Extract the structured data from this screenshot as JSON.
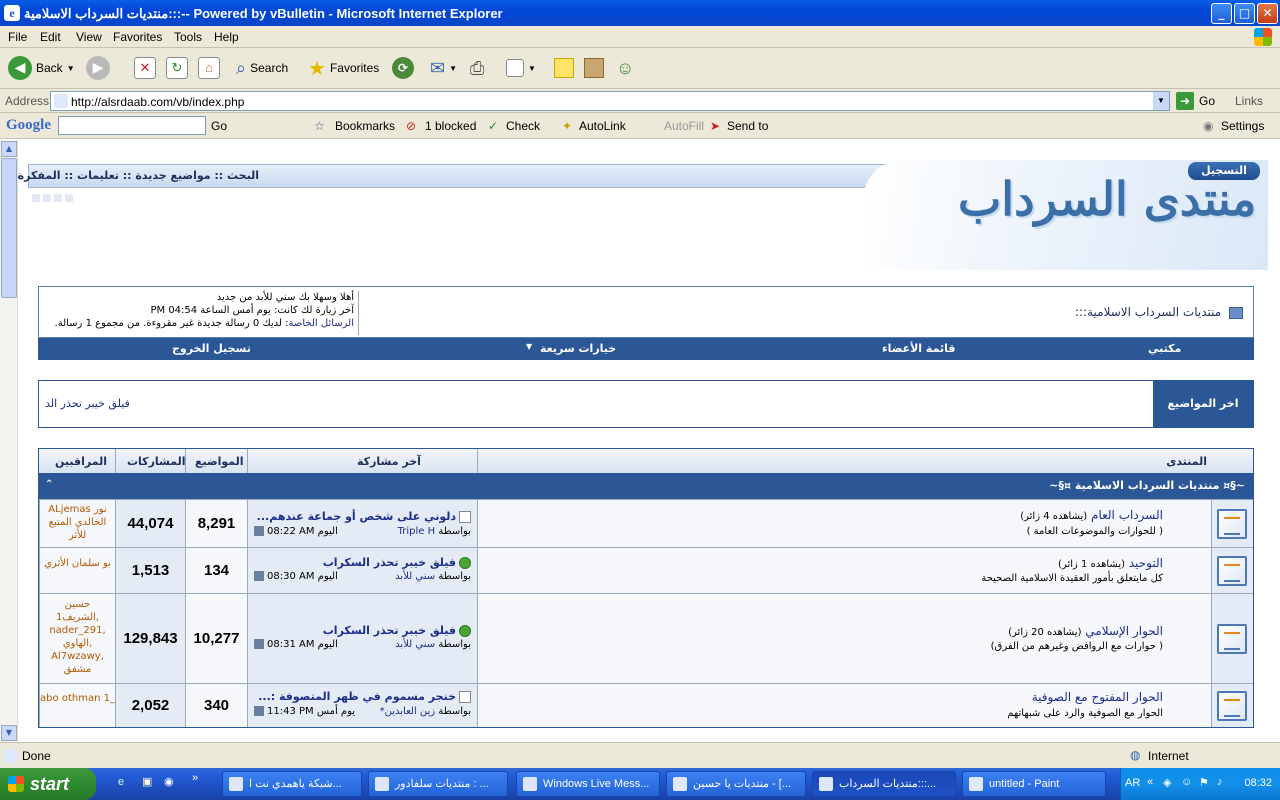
{
  "window": {
    "title": "منتديات السرداب الاسلامية:::-- Powered by vBulletin - Microsoft Internet Explorer",
    "min": "_",
    "max": "□",
    "close": "✕"
  },
  "menu": [
    "File",
    "Edit",
    "View",
    "Favorites",
    "Tools",
    "Help"
  ],
  "toolbar": {
    "back": "Back",
    "search": "Search",
    "favorites": "Favorites"
  },
  "address": {
    "label": "Address",
    "url": "http://alsrdaab.com/vb/index.php",
    "go": "Go",
    "links": "Links"
  },
  "google": {
    "logo": "Google",
    "go": "Go",
    "bookmarks": "Bookmarks",
    "blocked": "1 blocked",
    "check": "Check",
    "autolink": "AutoLink",
    "autofill": "AutoFill",
    "sendto": "Send to",
    "settings": "Settings"
  },
  "forum": {
    "header_links": "البحث :: مواضيع جديدة :: تعليمات :: المفكرة",
    "register": "التسجيل",
    "logo": "منتدى السرداب",
    "breadcrumb": "منتديات السرداب الاسلامية:::",
    "welcome": "أهلا وسهلا بك سني للأبد من جديد",
    "last_visit": "آخر زيارة لك كانت: يوم أمس الساعة 04:54 PM",
    "pm_label": "الرسائل الخاصة",
    "pm_text": ": لديك 0 رسالة جديدة غير مقروءة. من مجموع 1 رسالة.",
    "nav": {
      "office": "مكتبي",
      "members": "قائمة الأعضاء",
      "quick": "خيارات سريعة",
      "logout": "تسجيل الخروج"
    },
    "latest_tag": "اخر المواضيع",
    "latest_item": "فيلق خيبر تحذر الد",
    "columns": {
      "forum": "المنتدى",
      "last_post": "آخر مشاركة",
      "threads": "المواضيع",
      "posts": "المشاركات",
      "mods": "المراقبين"
    },
    "category": "~§¤ منتديات السرداب الاسلامية ¤§~",
    "collapse": "⌃",
    "rows": [
      {
        "title": "السرداب العام",
        "viewers": "(يشاهده 4 زائر)",
        "desc": "( للحوارات والموضوعات العامة )",
        "lp_title": "دلوني على شخص أو جماعة عندهم...",
        "lp_by": "بواسطة",
        "lp_user": "Triple H",
        "lp_day": "اليوم",
        "lp_time": "08:22 AM",
        "threads": "8,291",
        "posts": "44,074",
        "mods": "ALjemas نور الخالدي المتبع للأثر"
      },
      {
        "title": "التوحيد",
        "viewers": "(يشاهده 1 زائر)",
        "desc": "كل مايتعلق بأمور العقيدة الاسلامية الصحيحة",
        "lp_title": "فيلق خيبر تحذر السكراب",
        "lp_by": "بواسطة",
        "lp_user": "سني للأبد",
        "lp_day": "اليوم",
        "lp_time": "08:30 AM",
        "threads": "134",
        "posts": "1,513",
        "mods": "بو سلمان الأثري"
      },
      {
        "title": "الحوار الإسلامي",
        "viewers": "(يشاهده 20 زائر)",
        "desc": "( حوارات مع الروافض وغيرهم من الفرق)",
        "lp_title": "فيلق خيبر تحذر السكراب",
        "lp_by": "بواسطة",
        "lp_user": "سني للأبد",
        "lp_day": "اليوم",
        "lp_time": "08:31 AM",
        "threads": "10,277",
        "posts": "129,843",
        "mods": "حسين الشريف1, nader_291, الهاوي, Al7wzawy, مشفق"
      },
      {
        "title": "الحوار المفتوح مع الصوفية",
        "viewers": "",
        "desc": "الحوار مع الصوفية والرد على شبهاتهم",
        "lp_title": "خنجر مسموم في ظهر المتصوفة :...",
        "lp_by": "بواسطة",
        "lp_user": "زين العابدين*",
        "lp_day": "يوم أمس",
        "lp_time": "11:43 PM",
        "threads": "340",
        "posts": "2,052",
        "mods": "abo othman 1_"
      }
    ]
  },
  "status": {
    "done": "Done",
    "zone": "Internet"
  },
  "taskbar": {
    "start": "start",
    "tasks": [
      "شبكة ياهمدي نت ا...",
      "منتديات سلفادور : ...",
      "Windows Live Mess...",
      "منتديات يا حسين - [...",
      "منتديات السرداب:::...",
      "untitled - Paint"
    ],
    "lang": "AR",
    "clock": "08:32"
  }
}
